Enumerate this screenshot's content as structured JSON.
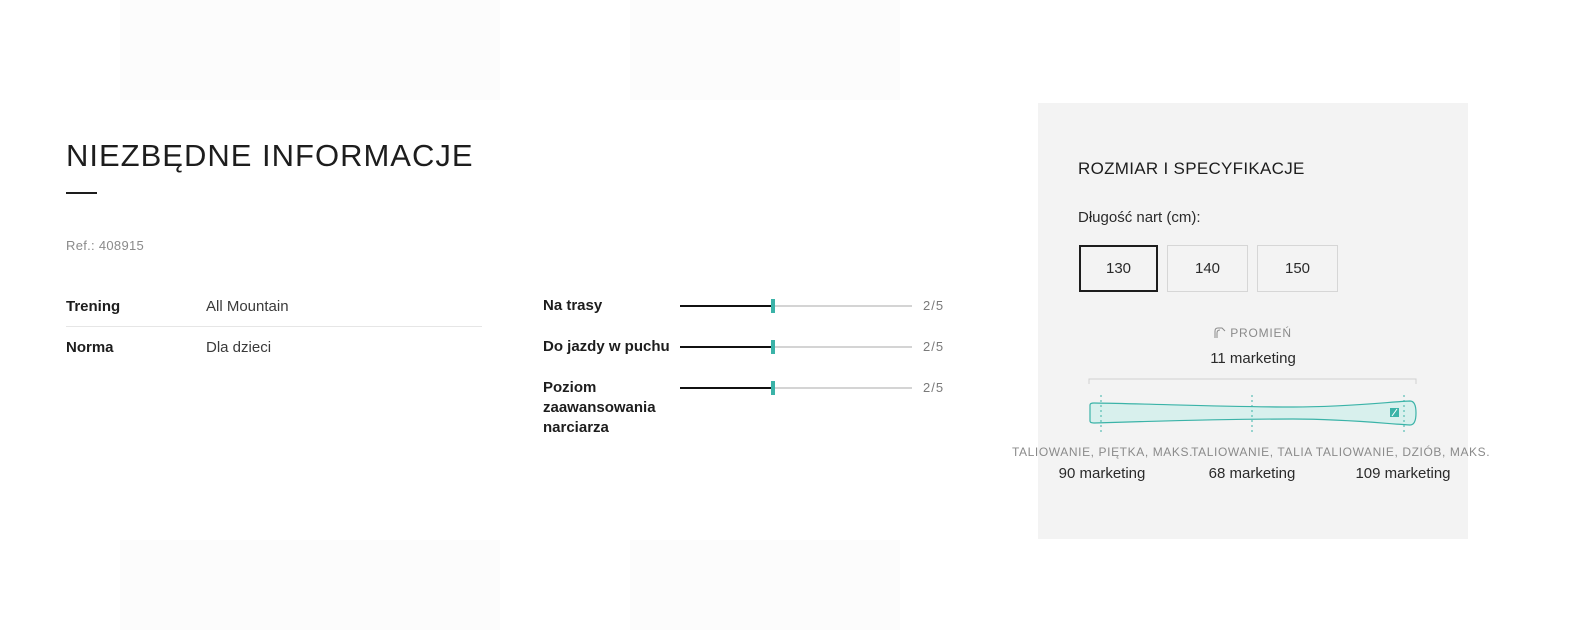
{
  "essential_info": {
    "title": "NIEZBĘDNE INFORMACJE",
    "ref": "Ref.: 408915",
    "rows": [
      {
        "label": "Trening",
        "value": "All Mountain"
      },
      {
        "label": "Norma",
        "value": "Dla dzieci"
      }
    ],
    "ratings": [
      {
        "label": "Na trasy",
        "score": "2/5",
        "level": 0.4
      },
      {
        "label": "Do jazdy w puchu",
        "score": "2/5",
        "level": 0.4
      },
      {
        "label": "Poziom zaawansowania narciarza",
        "score": "2/5",
        "level": 0.4
      }
    ]
  },
  "specs": {
    "title": "ROZMIAR I SPECYFIKACJE",
    "length_label": "Długość nart (cm):",
    "sizes": [
      "130",
      "140",
      "150"
    ],
    "selected_size": "130",
    "radius": {
      "label": "PROMIEŃ",
      "value": "11 marketing",
      "icon": "ski-radius-icon"
    },
    "sidecut": [
      {
        "label": "TALIOWANIE, PIĘTKA, MAKS.",
        "value": "90 marketing"
      },
      {
        "label": "TALIOWANIE, TALIA",
        "value": "68 marketing"
      },
      {
        "label": "TALIOWANIE, DZIÓB, MAKS.",
        "value": "109 marketing"
      }
    ]
  },
  "colors": {
    "accent": "#3bb3a8",
    "panel_bg": "#f3f3f3",
    "text": "#1d1d1d"
  }
}
